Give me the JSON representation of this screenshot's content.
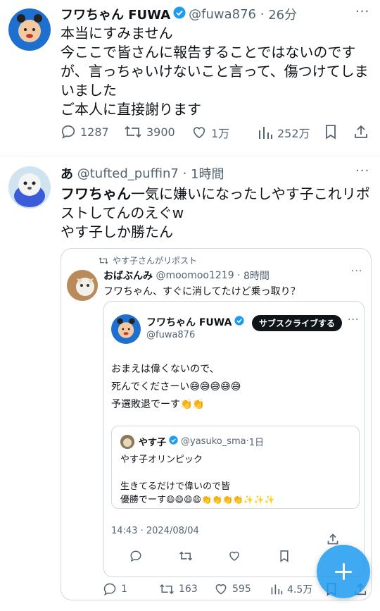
{
  "tweet1": {
    "display_name": "フワちゃん FUWA",
    "handle": "@fuwa876",
    "time": "26分",
    "lines": [
      "本当にすみません",
      "今ここで皆さんに報告することではないのです",
      "が、言っちゃいけないこと言って、傷つけてしま",
      "いました",
      "ご本人に直接謝ります"
    ],
    "replies": "1287",
    "reposts": "3900",
    "likes": "1万",
    "views": "252万"
  },
  "tweet2": {
    "display_name": "あ",
    "handle": "@tufted_puffin7",
    "time": "1時間",
    "line1_name": "フワちゃん",
    "line1_rest": "一気に嫌いになったしやす子これリポ",
    "lines": [
      "ストしてんのえぐw",
      "やす子しか勝たん"
    ],
    "replies": "1",
    "reposts": "163",
    "likes": "595",
    "views": "4.5万"
  },
  "quote": {
    "repost_by": "やす子さんがリポスト",
    "display_name": "おばぶんみ",
    "handle": "@moomoo1219",
    "time": "8時間",
    "text": "フワちゃん、すぐに消してたけど乗っ取り？"
  },
  "inner": {
    "display_name": "フワちゃん FUWA",
    "handle": "@fuwa876",
    "subscribe": "サブスクライブする",
    "line1": "おまえは偉くないので、",
    "line2": "死んでくださーい",
    "line2_emoji": "😅😅😅😅😅",
    "line3": "予選敗退でーす",
    "line3_emoji": "👏👏",
    "timestamp": "14:43 · 2024/08/04"
  },
  "deep": {
    "display_name": "やす子",
    "handle": "@yasuko_sma",
    "time": "1日",
    "line1": "やす子オリンピック",
    "line2": "生きてるだけで偉いので皆",
    "line3": "優勝でーす",
    "line3_emoji": "😄😄😄😄👏👏👏👏✨✨✨"
  },
  "colors": {
    "accent": "#1d9bf0",
    "text": "#0f1419",
    "muted": "#536471",
    "border": "#cfd9de"
  },
  "icons": [
    "reply-icon",
    "repost-icon",
    "like-icon",
    "views-icon",
    "bookmark-icon",
    "share-icon",
    "verified-icon",
    "more-icon",
    "compose-icon"
  ]
}
